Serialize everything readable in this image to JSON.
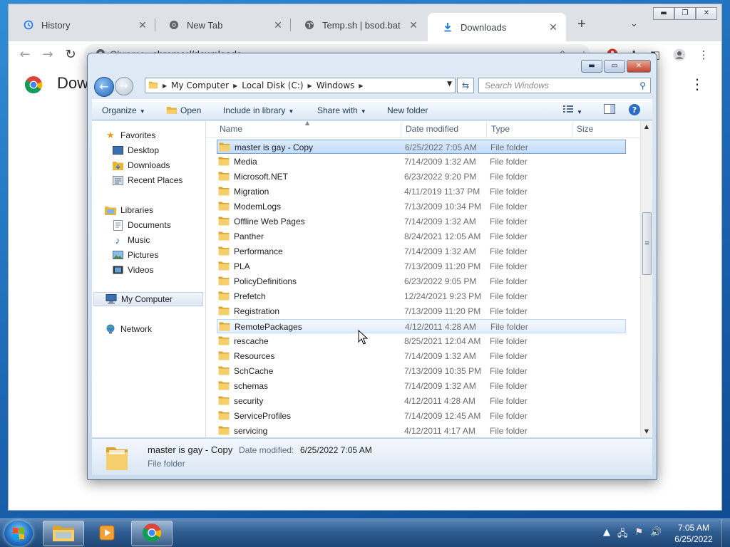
{
  "browser": {
    "tabs": [
      {
        "label": "History",
        "icon": "history-icon"
      },
      {
        "label": "New Tab",
        "icon": "chrome-icon"
      },
      {
        "label": "Temp.sh | bsod.bat",
        "icon": "globe-icon"
      },
      {
        "label": "Downloads",
        "icon": "download-icon"
      }
    ],
    "site_label": "Chrome",
    "url": "chrome://downloads",
    "page_title": "Downloads"
  },
  "explorer": {
    "breadcrumb": [
      "My Computer",
      "Local Disk (C:)",
      "Windows"
    ],
    "search_placeholder": "Search Windows",
    "commands": {
      "organize": "Organize",
      "open": "Open",
      "include": "Include in library",
      "share": "Share with",
      "new_folder": "New folder"
    },
    "nav": {
      "favorites": "Favorites",
      "desktop": "Desktop",
      "downloads": "Downloads",
      "recent": "Recent Places",
      "libraries": "Libraries",
      "documents": "Documents",
      "music": "Music",
      "pictures": "Pictures",
      "videos": "Videos",
      "computer": "My Computer",
      "network": "Network"
    },
    "columns": {
      "name": "Name",
      "date": "Date modified",
      "type": "Type",
      "size": "Size"
    },
    "files": [
      {
        "name": "master is gay - Copy",
        "date": "6/25/2022 7:05 AM",
        "type": "File folder"
      },
      {
        "name": "Media",
        "date": "7/14/2009 1:32 AM",
        "type": "File folder"
      },
      {
        "name": "Microsoft.NET",
        "date": "6/23/2022 9:20 PM",
        "type": "File folder"
      },
      {
        "name": "Migration",
        "date": "4/11/2019 11:37 PM",
        "type": "File folder"
      },
      {
        "name": "ModemLogs",
        "date": "7/13/2009 10:34 PM",
        "type": "File folder"
      },
      {
        "name": "Offline Web Pages",
        "date": "7/14/2009 1:32 AM",
        "type": "File folder"
      },
      {
        "name": "Panther",
        "date": "8/24/2021 12:05 AM",
        "type": "File folder"
      },
      {
        "name": "Performance",
        "date": "7/14/2009 1:32 AM",
        "type": "File folder"
      },
      {
        "name": "PLA",
        "date": "7/13/2009 11:20 PM",
        "type": "File folder"
      },
      {
        "name": "PolicyDefinitions",
        "date": "6/23/2022 9:05 PM",
        "type": "File folder"
      },
      {
        "name": "Prefetch",
        "date": "12/24/2021 9:23 PM",
        "type": "File folder"
      },
      {
        "name": "Registration",
        "date": "7/13/2009 11:20 PM",
        "type": "File folder"
      },
      {
        "name": "RemotePackages",
        "date": "4/12/2011 4:28 AM",
        "type": "File folder"
      },
      {
        "name": "rescache",
        "date": "8/25/2021 12:04 AM",
        "type": "File folder"
      },
      {
        "name": "Resources",
        "date": "7/14/2009 1:32 AM",
        "type": "File folder"
      },
      {
        "name": "SchCache",
        "date": "7/13/2009 10:35 PM",
        "type": "File folder"
      },
      {
        "name": "schemas",
        "date": "7/14/2009 1:32 AM",
        "type": "File folder"
      },
      {
        "name": "security",
        "date": "4/12/2011 4:28 AM",
        "type": "File folder"
      },
      {
        "name": "ServiceProfiles",
        "date": "7/14/2009 12:45 AM",
        "type": "File folder"
      },
      {
        "name": "servicing",
        "date": "4/12/2011 4:17 AM",
        "type": "File folder"
      }
    ],
    "selected_index": 0,
    "hover_index": 12,
    "details": {
      "name": "master is gay - Copy",
      "modified_label": "Date modified:",
      "modified_value": "6/25/2022 7:05 AM",
      "type": "File folder"
    }
  },
  "taskbar": {
    "time": "7:05 AM",
    "date": "6/25/2022"
  },
  "colors": {
    "folder": "#e8b63a",
    "selection": "#c1dcfc",
    "accent": "#1a73e8"
  }
}
